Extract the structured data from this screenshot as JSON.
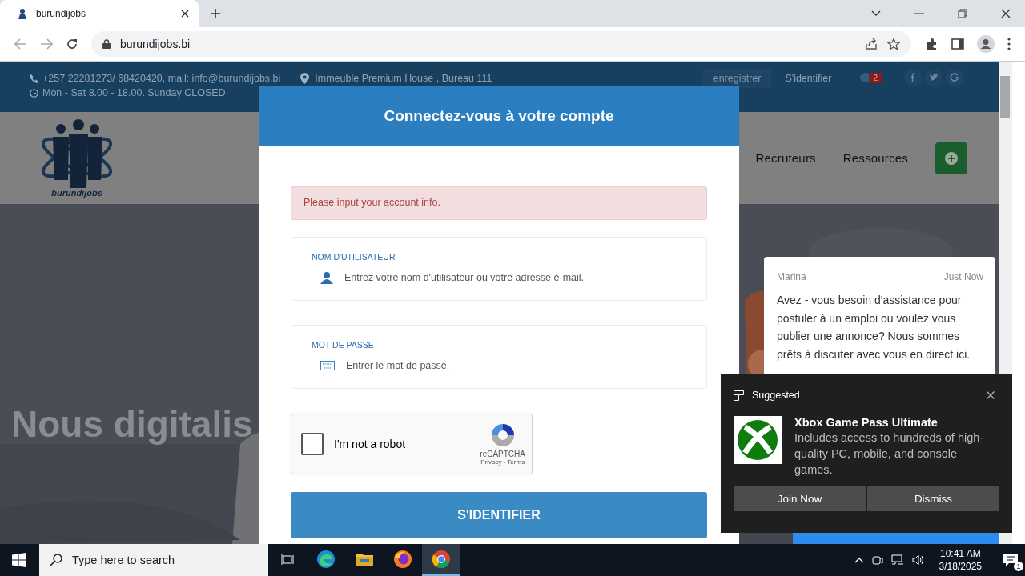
{
  "browser": {
    "tab_title": "burundijobs",
    "url": "burundijobs.bi"
  },
  "topbar": {
    "contact": "+257 22281273/ 68420420, mail: info@burundijobs.bi",
    "hours": "Mon - Sat 8.00 - 18.00. Sunday CLOSED",
    "address": "Immeuble Premium House , Bureau 111",
    "register": "enregistrer",
    "login": "S'identifier",
    "badge": "2"
  },
  "nav": {
    "logo_text": "burundijobs",
    "links": [
      "Recruteurs",
      "Ressources"
    ]
  },
  "hero": {
    "headline": "Nous digitalis"
  },
  "modal": {
    "title": "Connectez-vous à votre compte",
    "alert": "Please input your account info.",
    "fields": [
      {
        "kind": "user",
        "label": "NOM D'UTILISATEUR",
        "placeholder": "Entrez votre nom d'utilisateur ou votre adresse e-mail."
      },
      {
        "kind": "password",
        "label": "MOT DE PASSE",
        "placeholder": "Entrer le mot de passe."
      }
    ],
    "captcha": {
      "label": "I'm not a robot",
      "checked": false,
      "brand": "reCAPTCHA",
      "links": "Privacy - Terms"
    },
    "submit": "S'IDENTIFIER"
  },
  "chat": {
    "sender": "Marina",
    "time": "Just Now",
    "message": "Avez - vous besoin d'assistance pour postuler à un emploi ou voulez vous publier une annonce? Nous sommes prêts à discuter avec vous en direct ici."
  },
  "notification": {
    "header": "Suggested",
    "title": "Xbox Game Pass Ultimate",
    "body": "Includes access to hundreds of high-quality PC, mobile, and console games.",
    "buttons": [
      "Join Now",
      "Dismiss"
    ]
  },
  "taskbar": {
    "search_placeholder": "Type here to search",
    "apps": [
      {
        "kind": "taskview",
        "selected": false
      },
      {
        "kind": "edge",
        "selected": false
      },
      {
        "kind": "explorer",
        "selected": false
      },
      {
        "kind": "firefox",
        "selected": false
      },
      {
        "kind": "chrome",
        "selected": true
      }
    ],
    "time": "10:41 AM",
    "date": "3/18/2025",
    "notification_count": "1"
  }
}
